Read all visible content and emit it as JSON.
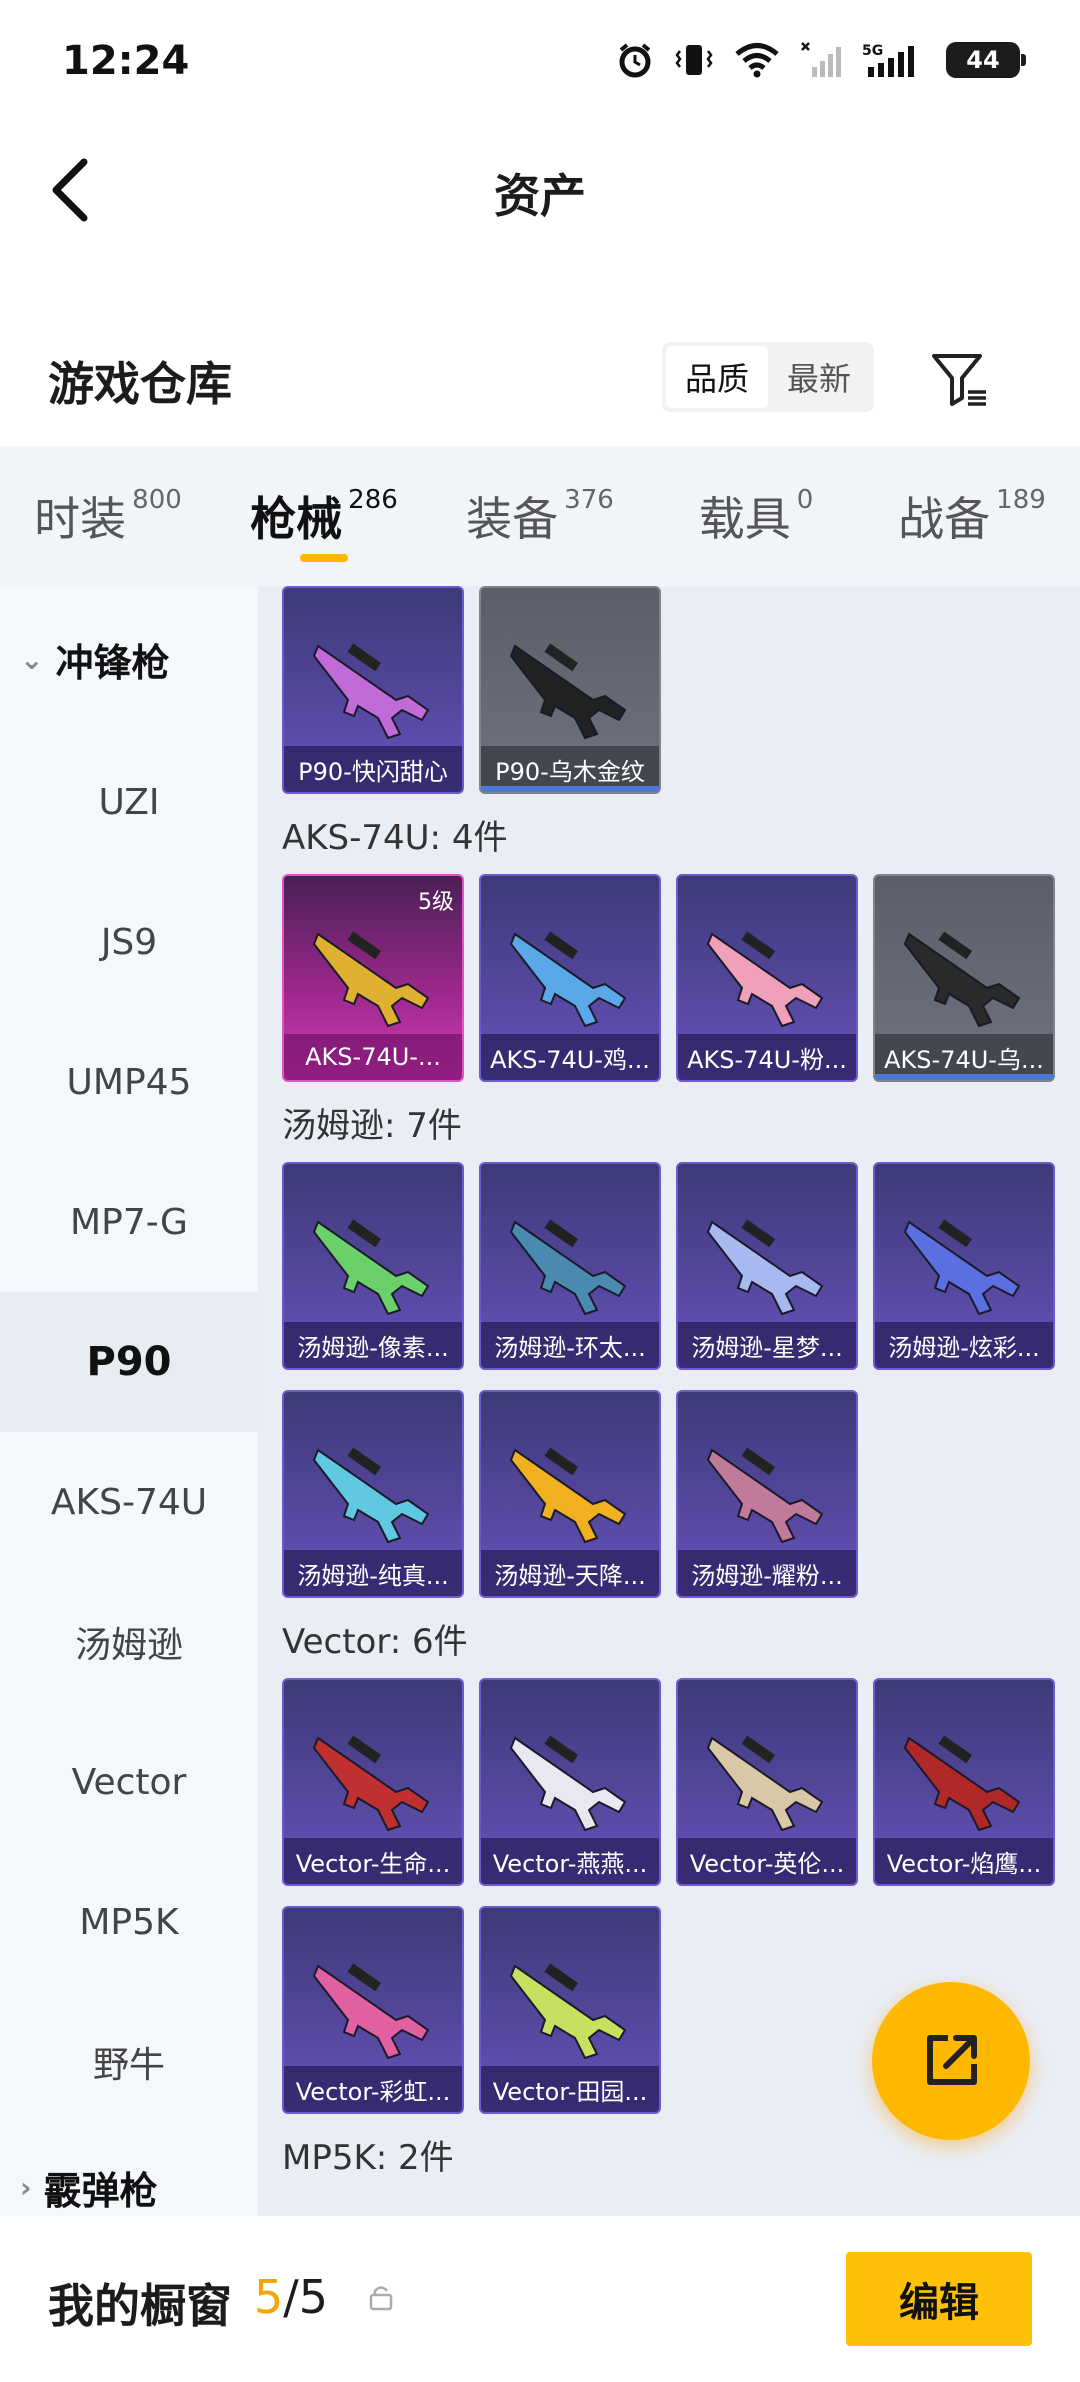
{
  "status": {
    "time": "12:24",
    "battery": "44"
  },
  "header": {
    "title": "资产"
  },
  "warehouse": {
    "title": "游戏仓库",
    "sort_options": [
      "品质",
      "最新"
    ],
    "active_sort": 0
  },
  "tabs": [
    {
      "label": "时装",
      "count": "800"
    },
    {
      "label": "枪械",
      "count": "286"
    },
    {
      "label": "装备",
      "count": "376"
    },
    {
      "label": "载具",
      "count": "0"
    },
    {
      "label": "战备",
      "count": "189"
    }
  ],
  "active_tab": 1,
  "sidebar": {
    "group_top": "冲锋枪",
    "items": [
      "UZI",
      "JS9",
      "UMP45",
      "MP7-G",
      "P90",
      "AKS-74U",
      "汤姆逊",
      "Vector",
      "MP5K",
      "野牛"
    ],
    "active_item": "P90",
    "group_bottom": "霰弹枪"
  },
  "sections": [
    {
      "title": "",
      "items": [
        {
          "label": "P90-快闪甜心",
          "color": "#c06bd8",
          "style": "purple"
        },
        {
          "label": "P90-乌木金纹",
          "color": "#222222",
          "style": "gray"
        }
      ]
    },
    {
      "title": "AKS-74U: 4件",
      "items": [
        {
          "label": "AKS-74U-...",
          "color": "#e0b030",
          "style": "pink",
          "badge": "5级"
        },
        {
          "label": "AKS-74U-鸡...",
          "color": "#5aa8e8",
          "style": "purple"
        },
        {
          "label": "AKS-74U-粉...",
          "color": "#f0a0b8",
          "style": "purple"
        },
        {
          "label": "AKS-74U-乌...",
          "color": "#2a2a2a",
          "style": "gray"
        }
      ]
    },
    {
      "title": "汤姆逊: 7件",
      "items": [
        {
          "label": "汤姆逊-像素...",
          "color": "#6ad06a",
          "style": "purple"
        },
        {
          "label": "汤姆逊-环太...",
          "color": "#4a8ab0",
          "style": "purple"
        },
        {
          "label": "汤姆逊-星梦...",
          "color": "#a8b8f0",
          "style": "purple"
        },
        {
          "label": "汤姆逊-炫彩...",
          "color": "#5a70e0",
          "style": "purple"
        },
        {
          "label": "汤姆逊-纯真...",
          "color": "#60c8e0",
          "style": "purple"
        },
        {
          "label": "汤姆逊-天降...",
          "color": "#f0b020",
          "style": "purple"
        },
        {
          "label": "汤姆逊-耀粉...",
          "color": "#c07a9a",
          "style": "purple"
        }
      ]
    },
    {
      "title": "Vector: 6件",
      "items": [
        {
          "label": "Vector-生命...",
          "color": "#c03030",
          "style": "purple"
        },
        {
          "label": "Vector-燕燕...",
          "color": "#e8e8f0",
          "style": "purple"
        },
        {
          "label": "Vector-英伦...",
          "color": "#d8c8a8",
          "style": "purple"
        },
        {
          "label": "Vector-焰鹰...",
          "color": "#b02828",
          "style": "purple"
        },
        {
          "label": "Vector-彩虹...",
          "color": "#e060a0",
          "style": "purple"
        },
        {
          "label": "Vector-田园...",
          "color": "#c8e060",
          "style": "purple"
        }
      ]
    },
    {
      "title": "MP5K: 2件",
      "items": []
    }
  ],
  "bottom": {
    "window_label": "我的橱窗",
    "window_current": "5",
    "window_sep": "/",
    "window_total": "5",
    "edit_label": "编辑"
  },
  "colors": {
    "accent": "#ffb400",
    "edit": "#ffc107"
  }
}
